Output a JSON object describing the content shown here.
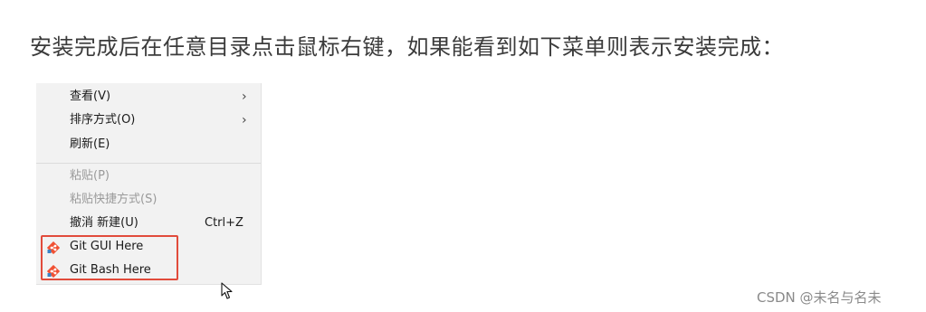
{
  "instruction_text": "安装完成后在任意目录点击鼠标右键，如果能看到如下菜单则表示安装完成：",
  "context_menu": {
    "items": [
      {
        "label": "查看(V)",
        "submenu": true,
        "enabled": true
      },
      {
        "label": "排序方式(O)",
        "submenu": true,
        "enabled": true
      },
      {
        "label": "刷新(E)",
        "submenu": false,
        "enabled": true
      },
      {
        "label": "粘贴(P)",
        "submenu": false,
        "enabled": false
      },
      {
        "label": "粘贴快捷方式(S)",
        "submenu": false,
        "enabled": false
      },
      {
        "label": "撤消 新建(U)",
        "shortcut": "Ctrl+Z",
        "enabled": true
      },
      {
        "label": "Git GUI Here",
        "icon": "git-icon",
        "enabled": true
      },
      {
        "label": "Git Bash Here",
        "icon": "git-icon",
        "enabled": true
      }
    ],
    "submenu_arrow": "›"
  },
  "highlight_color": "#e14b3b",
  "watermark": "CSDN @未名与名未",
  "icons": [
    "git-icon",
    "mouse-cursor-icon",
    "chevron-right-icon"
  ]
}
